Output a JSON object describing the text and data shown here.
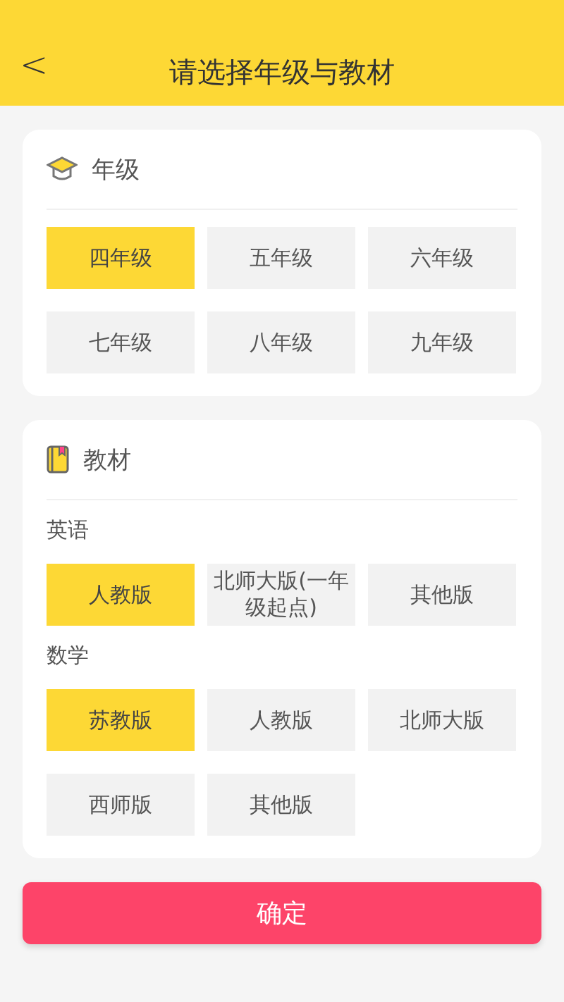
{
  "header": {
    "back": "<",
    "title": "请选择年级与教材"
  },
  "grade_card": {
    "title": "年级",
    "options": [
      {
        "label": "四年级",
        "selected": true
      },
      {
        "label": "五年级",
        "selected": false
      },
      {
        "label": "六年级",
        "selected": false
      },
      {
        "label": "七年级",
        "selected": false
      },
      {
        "label": "八年级",
        "selected": false
      },
      {
        "label": "九年级",
        "selected": false
      }
    ]
  },
  "textbook_card": {
    "title": "教材",
    "subjects": [
      {
        "name": "英语",
        "options": [
          {
            "label": "人教版",
            "selected": true
          },
          {
            "label": "北师大版(一年级起点)",
            "selected": false
          },
          {
            "label": "其他版",
            "selected": false
          }
        ]
      },
      {
        "name": "数学",
        "options": [
          {
            "label": "苏教版",
            "selected": true
          },
          {
            "label": "人教版",
            "selected": false
          },
          {
            "label": "北师大版",
            "selected": false
          },
          {
            "label": "西师版",
            "selected": false
          },
          {
            "label": "其他版",
            "selected": false
          }
        ]
      }
    ]
  },
  "confirm_button": "确定"
}
